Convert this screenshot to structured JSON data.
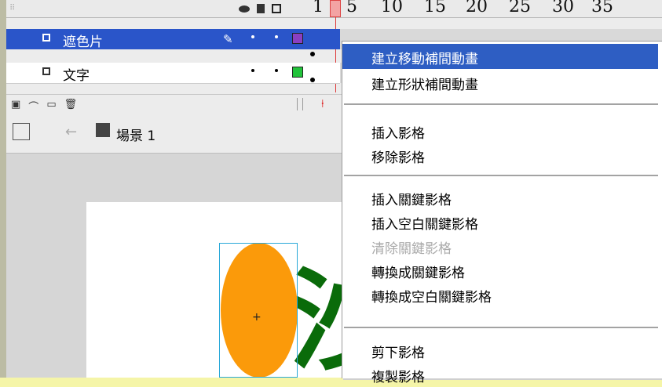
{
  "timeline": {
    "ruler_ticks": [
      "1",
      "5",
      "10",
      "15",
      "20",
      "25",
      "30",
      "35"
    ],
    "layers": [
      {
        "name": "遮色片",
        "color": "#8a3fc1",
        "selected": true
      },
      {
        "name": "文字",
        "color": "#22c33b",
        "selected": false
      }
    ]
  },
  "scene": {
    "label": "場景 1"
  },
  "stage": {
    "text_glyph": "沙"
  },
  "menu": {
    "items": [
      {
        "label": "建立移動補間動畫",
        "state": "active"
      },
      {
        "label": "建立形狀補間動畫",
        "state": "normal"
      },
      {
        "label": "插入影格",
        "state": "normal"
      },
      {
        "label": "移除影格",
        "state": "normal"
      },
      {
        "label": "插入關鍵影格",
        "state": "normal"
      },
      {
        "label": "插入空白關鍵影格",
        "state": "normal"
      },
      {
        "label": "清除關鍵影格",
        "state": "disabled"
      },
      {
        "label": "轉換成關鍵影格",
        "state": "normal"
      },
      {
        "label": "轉換成空白關鍵影格",
        "state": "normal"
      },
      {
        "label": "剪下影格",
        "state": "normal"
      },
      {
        "label": "複製影格",
        "state": "normal"
      }
    ]
  }
}
